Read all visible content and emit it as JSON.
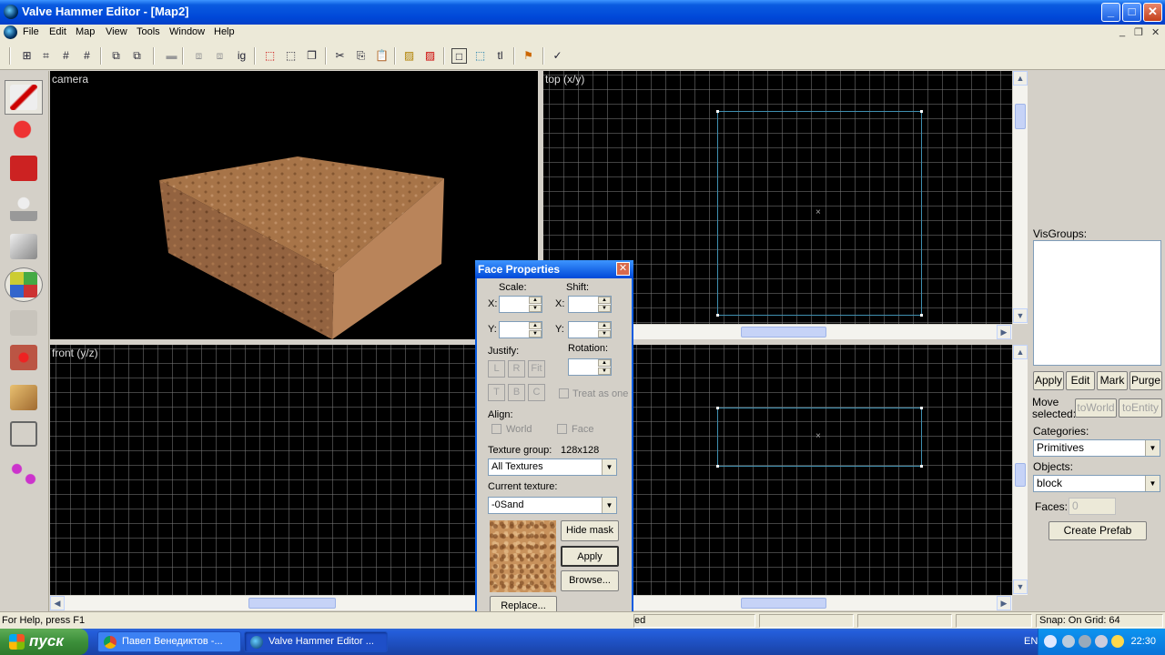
{
  "window": {
    "title": "Valve Hammer Editor - [Map2]",
    "controls": {
      "minimize": "_",
      "maximize": "□",
      "close": "✕"
    }
  },
  "menu": {
    "items": [
      "File",
      "Edit",
      "Map",
      "View",
      "Tools",
      "Window",
      "Help"
    ],
    "mdi_controls": {
      "minimize": "_",
      "restore": "❐",
      "close": "✕"
    }
  },
  "toolbar": {
    "icons": [
      "grid-icon",
      "grid-3d-icon",
      "grid-smaller-icon",
      "grid-larger-icon",
      "group-icon",
      "ungroup-icon",
      "hide-icon",
      "carve-icon",
      "hollow-icon",
      "ignore-groups-label",
      "select-all-icon",
      "select-icon",
      "cut-icon",
      "copy-icon",
      "paste-icon",
      "hatch-icon",
      "hatch2-icon",
      "texture-lock-icon",
      "select-tool-icon",
      "tl-label",
      "run-icon",
      "check-icon"
    ],
    "ignore_groups_label": "ig",
    "tl_label": "tl"
  },
  "palette": {
    "tools": [
      "selection-tool",
      "magnify-tool",
      "camera-tool",
      "entity-tool",
      "block-tool",
      "texture-application-tool",
      "apply-current-texture-tool",
      "decal-tool",
      "clipping-tool",
      "vertex-tool",
      "path-tool"
    ]
  },
  "viewports": {
    "camera": {
      "label": "camera"
    },
    "top": {
      "label": "top (x/y)"
    },
    "front": {
      "label": "front (y/z)"
    },
    "side": {
      "label": ""
    }
  },
  "right_panel": {
    "visgroups_label": "VisGroups:",
    "buttons": {
      "apply": "Apply",
      "edit": "Edit",
      "mark": "Mark",
      "purge": "Purge"
    },
    "move_selected_label": "Move selected:",
    "to_world": "toWorld",
    "to_entity": "toEntity",
    "categories_label": "Categories:",
    "categories_value": "Primitives",
    "objects_label": "Objects:",
    "objects_value": "block",
    "faces_label": "Faces:",
    "faces_value": "0",
    "create_prefab": "Create Prefab"
  },
  "face_properties": {
    "title": "Face Properties",
    "scale_label": "Scale:",
    "shift_label": "Shift:",
    "x_label": "X:",
    "y_label": "Y:",
    "justify_label": "Justify:",
    "rotation_label": "Rotation:",
    "justify_buttons": [
      "L",
      "R",
      "Fit",
      "T",
      "B",
      "C"
    ],
    "treat_as_one": "Treat as one",
    "align_label": "Align:",
    "align_world": "World",
    "align_face": "Face",
    "texture_group_label": "Texture group:",
    "texture_size": "128x128",
    "texture_group_value": "All Textures",
    "current_texture_label": "Current texture:",
    "current_texture_value": "-0Sand",
    "hide_mask": "Hide mask",
    "apply": "Apply",
    "browse": "Browse...",
    "replace": "Replace..."
  },
  "status": {
    "help": "For Help, press F1",
    "partial": "ed",
    "snap": "Snap: On Grid: 64"
  },
  "taskbar": {
    "start": "пуск",
    "tasks": [
      {
        "label": "Павел Венедиктов -...",
        "icon": "chrome-icon"
      },
      {
        "label": "Valve Hammer Editor ...",
        "icon": "hammer-icon"
      }
    ],
    "lang": "EN",
    "clock": "22:30"
  }
}
